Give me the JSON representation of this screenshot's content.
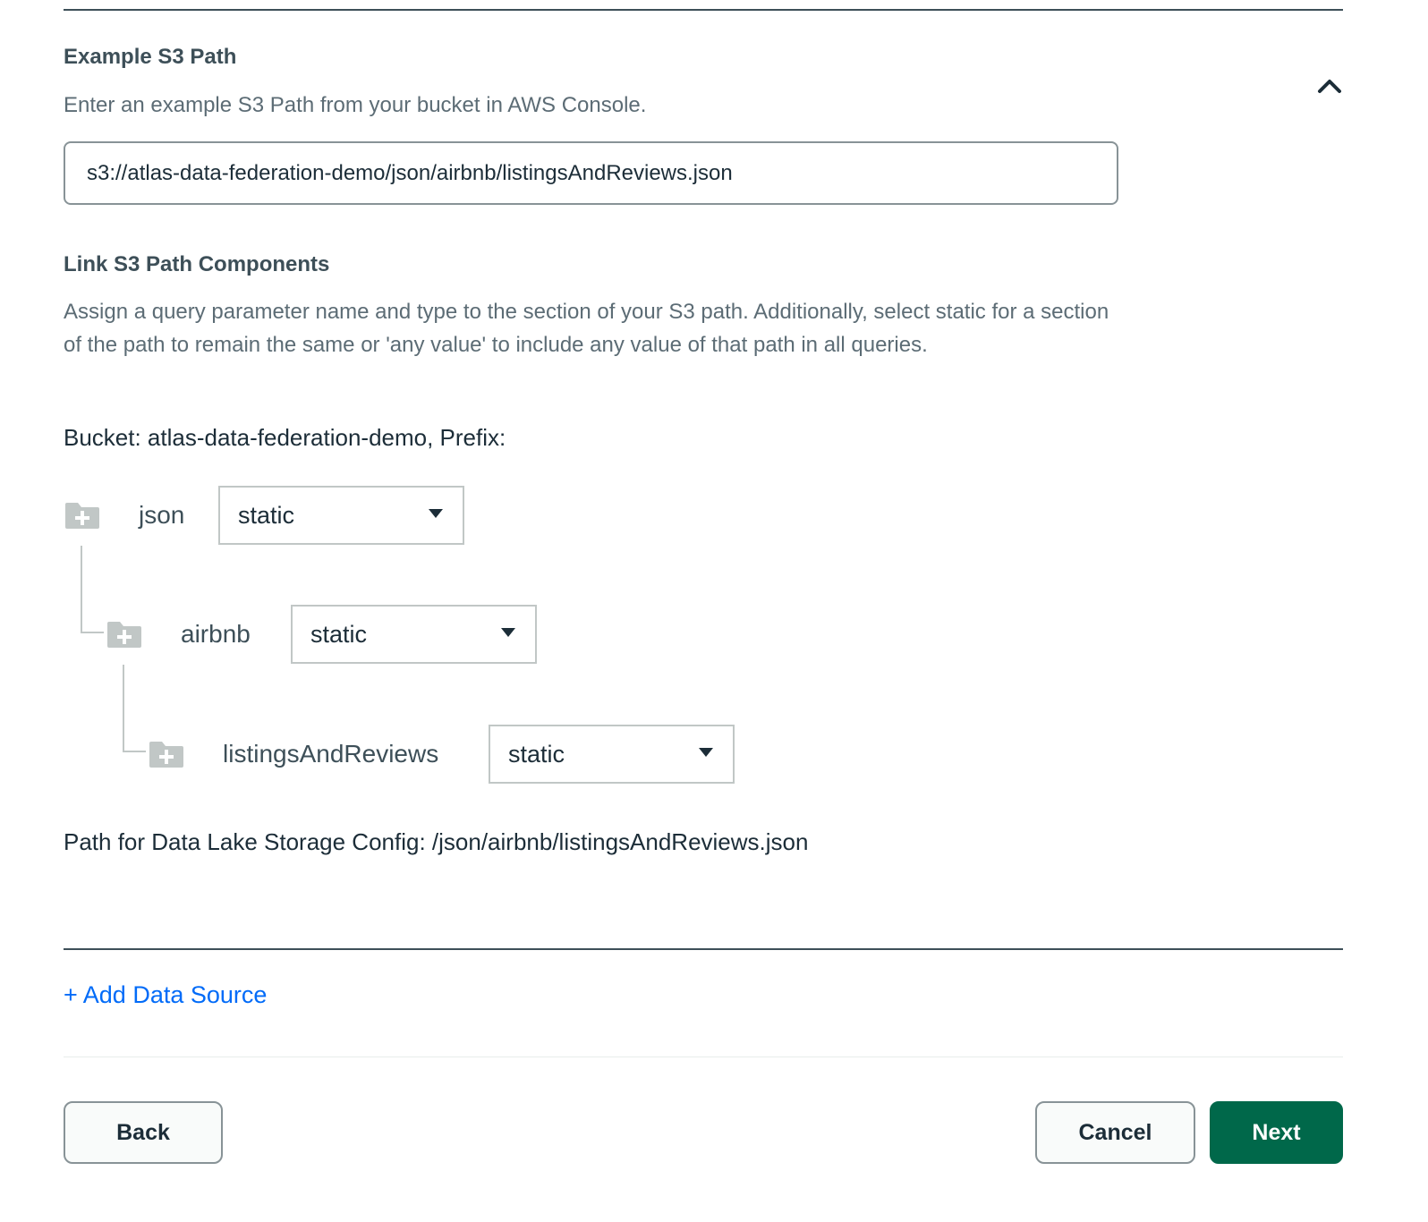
{
  "example_path": {
    "title": "Example S3 Path",
    "description": "Enter an example S3 Path from your bucket in AWS Console.",
    "input_value": "s3://atlas-data-federation-demo/json/airbnb/listingsAndReviews.json",
    "collapse_icon": "chevron-up-icon"
  },
  "link_components": {
    "title": "Link S3 Path Components",
    "description": "Assign a query parameter name and type to the section of your S3 path. Additionally, select static for a section of the path to remain the same or 'any value' to include any value of that path in all queries.",
    "bucket_line": "Bucket: atlas-data-federation-demo, Prefix:",
    "components": [
      {
        "name": "json",
        "type": "static",
        "icon": "folder-add-icon"
      },
      {
        "name": "airbnb",
        "type": "static",
        "icon": "folder-add-icon"
      },
      {
        "name": "listingsAndReviews",
        "type": "static",
        "icon": "folder-add-icon"
      }
    ],
    "config_path": "Path for Data Lake Storage Config: /json/airbnb/listingsAndReviews.json"
  },
  "add_data_source": "+ Add Data Source",
  "footer": {
    "back": "Back",
    "cancel": "Cancel",
    "next": "Next"
  },
  "colors": {
    "primary": "#00684a",
    "link": "#016bf8",
    "text": "#1c2d38",
    "muted": "#5c6c75"
  }
}
